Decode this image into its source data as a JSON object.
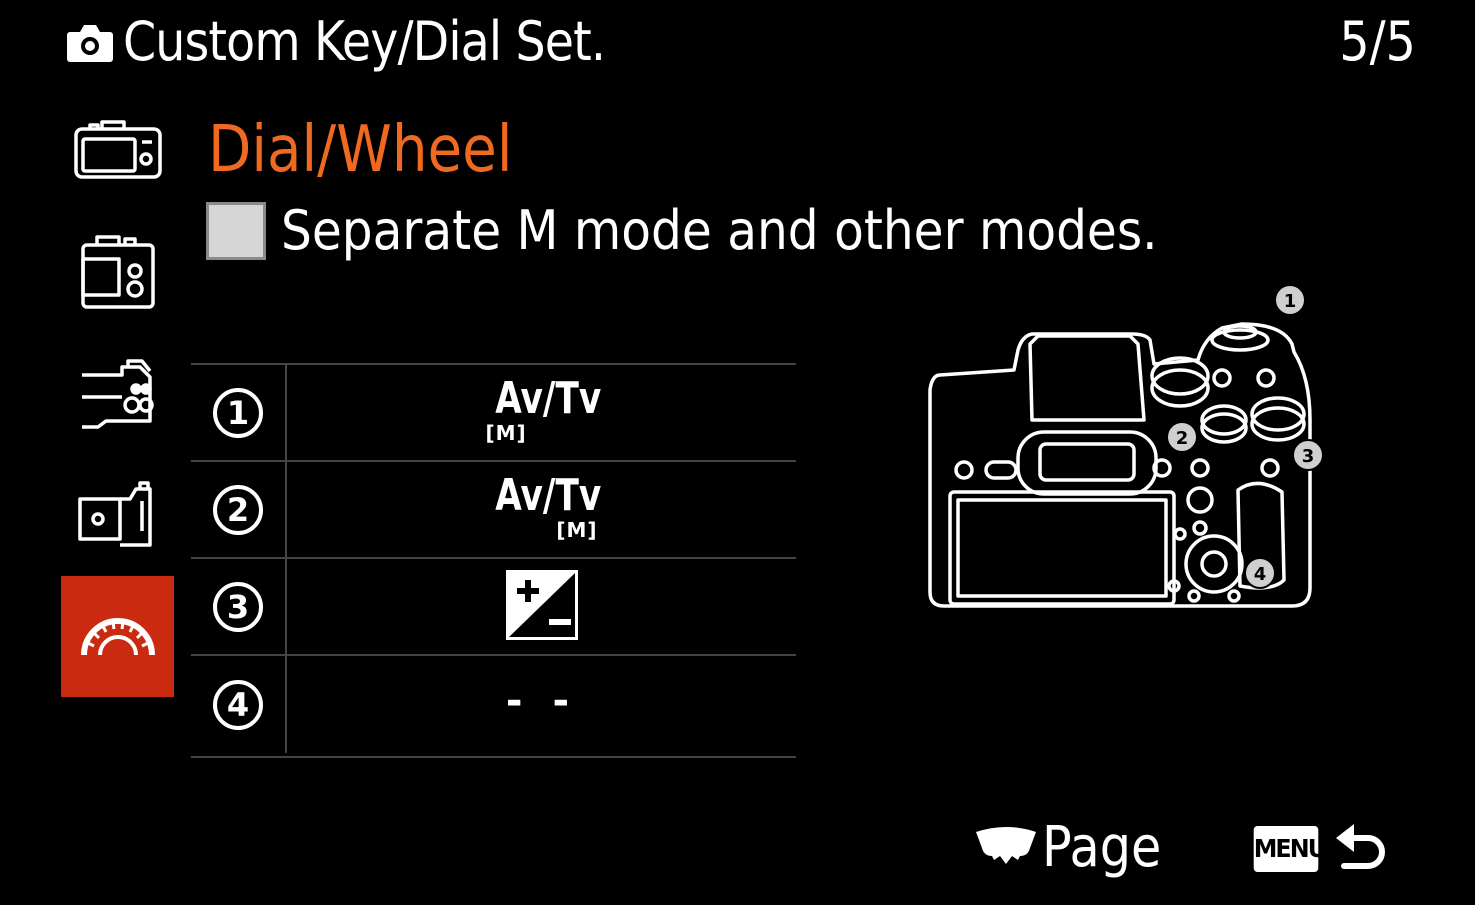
{
  "header": {
    "title": "Custom Key/Dial Set.",
    "page_indicator": "5/5",
    "icon": "camera-icon"
  },
  "sidebar": {
    "items": [
      {
        "icon": "camera-body-front-icon",
        "active": false
      },
      {
        "icon": "camera-body-back-icon",
        "active": false
      },
      {
        "icon": "camera-grip-buttons-icon",
        "active": false
      },
      {
        "icon": "camera-side-icon",
        "active": false
      },
      {
        "icon": "dial-icon",
        "active": true
      }
    ],
    "active_color": "#c92a10"
  },
  "section": {
    "title": "Dial/Wheel",
    "title_color": "#ef6a20",
    "option_label": "Separate M mode and other modes.",
    "option_checked": false
  },
  "dials": [
    {
      "number": "1",
      "value": "Av/Tv",
      "sub": "[M]",
      "sub_position": "left"
    },
    {
      "number": "2",
      "value": "Av/Tv",
      "sub": "[M]",
      "sub_position": "right"
    },
    {
      "number": "3",
      "value_icon": "exposure-compensation-icon"
    },
    {
      "number": "4",
      "value": "- -"
    }
  ],
  "diagram": {
    "markers": [
      "1",
      "2",
      "3",
      "4"
    ]
  },
  "footer": {
    "page_label": "Page",
    "menu_label": "MENU",
    "back_icon": "back-arrow-icon"
  }
}
